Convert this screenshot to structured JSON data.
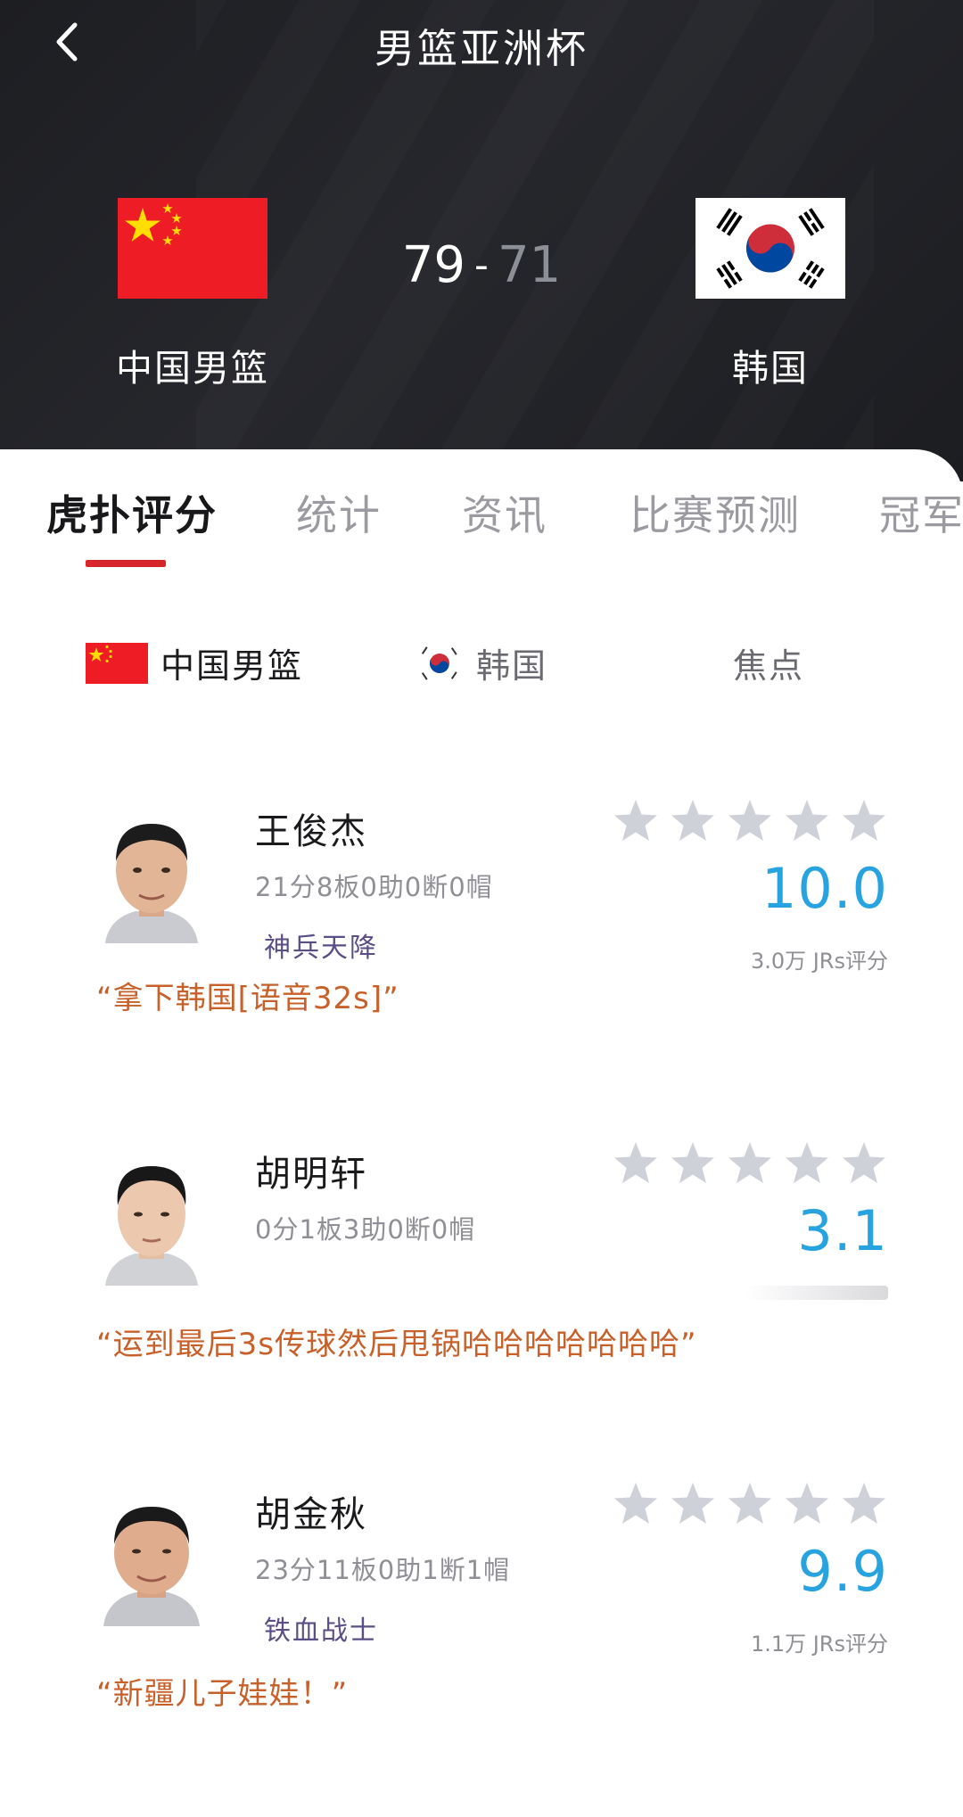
{
  "header": {
    "title": "男篮亚洲杯",
    "home_team": "中国男篮",
    "away_team": "韩国",
    "home_score": "79",
    "score_separator": "-",
    "away_score": "71"
  },
  "tabs": [
    {
      "label": "虎扑评分",
      "active": true
    },
    {
      "label": "统计",
      "active": false
    },
    {
      "label": "资讯",
      "active": false
    },
    {
      "label": "比赛预测",
      "active": false
    },
    {
      "label": "冠军",
      "active": false
    }
  ],
  "subtabs": [
    {
      "label": "中国男篮",
      "icon": "china-flag-icon"
    },
    {
      "label": "韩国",
      "icon": "korea-flag-icon"
    },
    {
      "label": "焦点"
    }
  ],
  "players": [
    {
      "name": "王俊杰",
      "stats": "21分8板0助0断0帽",
      "title": "神兵天降",
      "rating": "10.0",
      "votes": "3.0万 JRs评分",
      "comment": "“拿下韩国[语音32s]”",
      "stars": 5
    },
    {
      "name": "胡明轩",
      "stats": "0分1板3助0断0帽",
      "title": "",
      "rating": "3.1",
      "votes": "",
      "comment": "“运到最后3s传球然后甩锅哈哈哈哈哈哈哈”",
      "stars": 5
    },
    {
      "name": "胡金秋",
      "stats": "23分11板0助1断1帽",
      "title": "铁血战士",
      "rating": "9.9",
      "votes": "1.1万 JRs评分",
      "comment": "“新疆儿子娃娃！”",
      "stars": 5
    }
  ],
  "colors": {
    "header_bg": "#1f2024",
    "tab_accent": "#d6262c",
    "rating_blue": "#27a3e0",
    "comment_orange": "#c8602a",
    "title_purple": "#5a4e86",
    "star_gray": "#cfd1d9"
  }
}
